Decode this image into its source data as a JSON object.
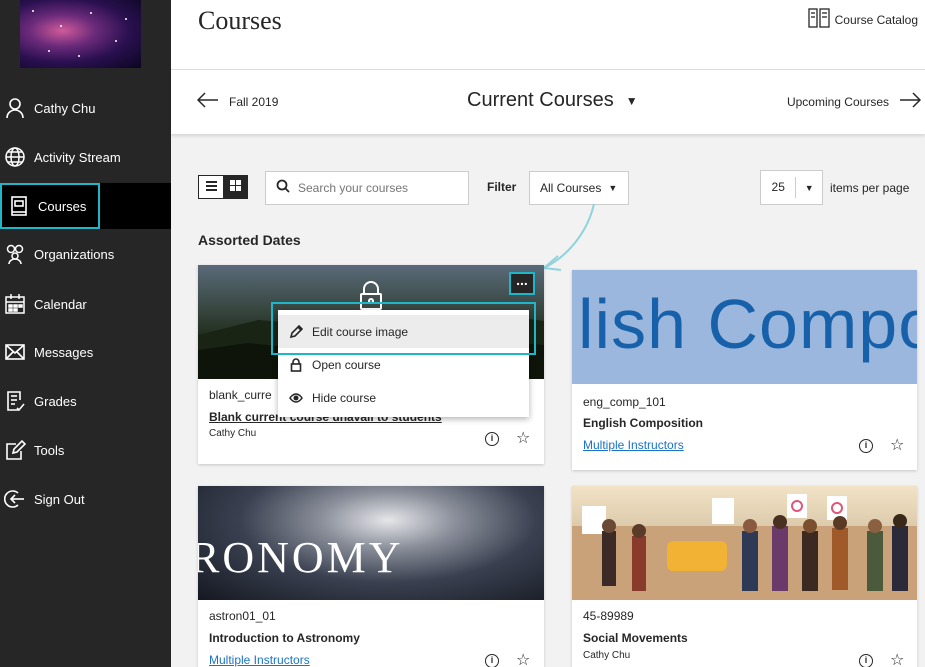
{
  "sidebar": {
    "items": [
      {
        "label": "Cathy Chu",
        "icon": "user-icon"
      },
      {
        "label": "Activity Stream",
        "icon": "globe-icon"
      },
      {
        "label": "Courses",
        "icon": "courses-icon"
      },
      {
        "label": "Organizations",
        "icon": "organizations-icon"
      },
      {
        "label": "Calendar",
        "icon": "calendar-icon"
      },
      {
        "label": "Messages",
        "icon": "envelope-icon"
      },
      {
        "label": "Grades",
        "icon": "grades-icon"
      },
      {
        "label": "Tools",
        "icon": "tools-icon"
      },
      {
        "label": "Sign Out",
        "icon": "sign-out-icon"
      }
    ],
    "active_item": "Courses"
  },
  "header": {
    "title": "Courses",
    "catalog_link": "Course Catalog"
  },
  "term_nav": {
    "previous": "Fall 2019",
    "current": "Current Courses",
    "next": "Upcoming Courses"
  },
  "toolbar": {
    "search_placeholder": "Search your courses",
    "filter_label": "Filter",
    "filter_value": "All Courses",
    "per_page_value": "25",
    "per_page_label": "items per page"
  },
  "section": {
    "heading": "Assorted Dates"
  },
  "courses": [
    {
      "id": "blank_curre",
      "name": "Blank current course unavail to students",
      "instructor": "Cathy Chu"
    },
    {
      "id": "eng_comp_101",
      "name": "English Composition",
      "instructor": "Multiple Instructors",
      "image_text": "lish Compo"
    },
    {
      "id": "astron01_01",
      "name": "Introduction to Astronomy",
      "instructor": "Multiple Instructors",
      "image_text": "RONOMY"
    },
    {
      "id": "45-89989",
      "name": "Social Movements",
      "instructor": "Cathy Chu"
    }
  ],
  "course_menu": {
    "items": [
      {
        "label": "Edit course image",
        "icon": "pencil-icon"
      },
      {
        "label": "Open course",
        "icon": "lock-icon"
      },
      {
        "label": "Hide course",
        "icon": "eye-icon"
      }
    ],
    "more_button": "..."
  },
  "colors": {
    "sidebar_bg": "#262626",
    "focus_outline": "#1fb6c9",
    "link": "#1a73c8",
    "page_bg": "#f2f2f2"
  }
}
